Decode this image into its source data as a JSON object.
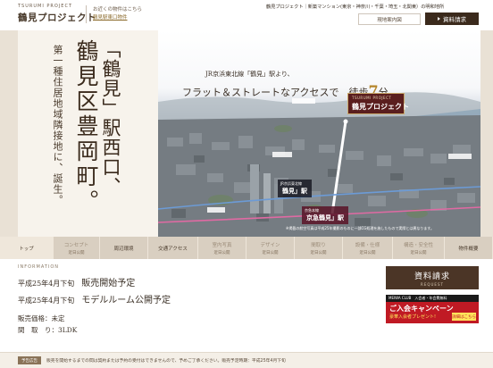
{
  "header": {
    "logo_en": "TSURUMI PROJECT",
    "logo_ja": "鶴見プロジェクト",
    "notice": "お近くの物件はこちら",
    "notice_link": "鶴見駅東口物件",
    "tagline": "鶴見プロジェクト｜新築マンション(東京・神奈川・千葉・埼玉・北関東）の明和地所",
    "map_button": "現地案内図",
    "request_button": "資料請求"
  },
  "hero": {
    "vertical_small": "第一種住居地域隣接地に、誕生。",
    "vertical_big_1": "「鶴見」駅西口、",
    "vertical_big_2": "鶴見区豊岡町。",
    "caption_1": "JR京浜東北線「鶴見」駅より、",
    "caption_2_pre": "フラット＆ストレートなアクセスで　徒歩",
    "caption_2_num": "7",
    "caption_2_post": "分",
    "project_label_en": "TSURUMI PROJECT",
    "project_label_ja": "鶴見プロジェクト",
    "station_jr_small": "JR京浜東北線",
    "station_jr": "鶴見」駅",
    "station_keikyu_small": "京急本線",
    "station_keikyu": "京急鶴見」駅",
    "note": "※掲載の航空写真は平成25年撮影のものに一部CG処理を施したもので実際とは異なります。"
  },
  "nav": [
    {
      "label": "トップ",
      "sub": "",
      "active": true,
      "dim": false
    },
    {
      "label": "コンセプト",
      "sub": "近日公開",
      "active": false,
      "dim": true
    },
    {
      "label": "周辺環境",
      "sub": "",
      "active": false,
      "dim": false
    },
    {
      "label": "交通アクセス",
      "sub": "",
      "active": false,
      "dim": false
    },
    {
      "label": "室内写真",
      "sub": "近日公開",
      "active": false,
      "dim": true
    },
    {
      "label": "デザイン",
      "sub": "近日公開",
      "active": false,
      "dim": true
    },
    {
      "label": "間取り",
      "sub": "近日公開",
      "active": false,
      "dim": true
    },
    {
      "label": "設備・仕様",
      "sub": "近日公開",
      "active": false,
      "dim": true
    },
    {
      "label": "構造・安全性",
      "sub": "近日公開",
      "active": false,
      "dim": true
    },
    {
      "label": "物件概要",
      "sub": "",
      "active": false,
      "dim": false
    }
  ],
  "info": {
    "label": "INFORMATION",
    "line1_date": "平成25年4月下旬",
    "line1_text": "販売開始予定",
    "line2_date": "平成25年4月下旬",
    "line2_text": "モデルルーム公開予定",
    "price": "販売価格：未定",
    "layout": "間　取　り：3LDK"
  },
  "side": {
    "request_title": "資料請求",
    "request_sub": "REQUEST",
    "banner_top": "MEIWA CLUB　入会者・年会費無料",
    "banner_line1": "ご入会キャンペーン",
    "banner_line2": "豪華入会者プレゼント!",
    "banner_go": "詳細はこちら"
  },
  "footer": {
    "badge": "予告広告",
    "text": "販売を開始するまでの間は契約または予約の受付はできませんので、予めご了承ください。販売予定時期：平成25年4月下旬"
  },
  "colors": {
    "brand_dark": "#3b2a1c",
    "accent_gold": "#b5852a",
    "nav_bg": "#d9cfc1",
    "banner_red": "#c01a24"
  }
}
